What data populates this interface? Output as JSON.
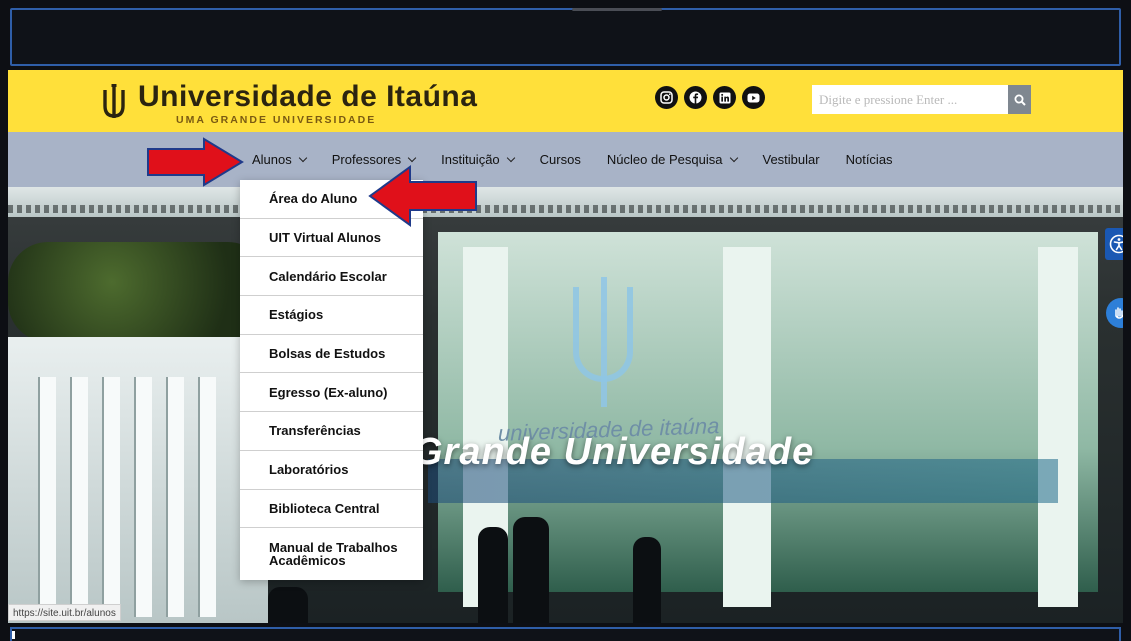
{
  "header": {
    "logo_title": "Universidade de Itaúna",
    "logo_subtitle": "UMA GRANDE UNIVERSIDADE",
    "social_icons": [
      "instagram-icon",
      "facebook-icon",
      "linkedin-icon",
      "youtube-icon"
    ],
    "search_placeholder": "Digite e pressione Enter ..."
  },
  "nav": {
    "items": [
      {
        "label": "Alunos",
        "has_dropdown": true
      },
      {
        "label": "Professores",
        "has_dropdown": true
      },
      {
        "label": "Instituição",
        "has_dropdown": true
      },
      {
        "label": "Cursos",
        "has_dropdown": false
      },
      {
        "label": "Núcleo de Pesquisa",
        "has_dropdown": true
      },
      {
        "label": "Vestibular",
        "has_dropdown": false
      },
      {
        "label": "Notícias",
        "has_dropdown": false
      }
    ]
  },
  "dropdown": {
    "items": [
      "Área do Aluno",
      "UIT Virtual Alunos",
      "Calendário Escolar",
      "Estágios",
      "Bolsas de Estudos",
      "Egresso (Ex-aluno)",
      "Transferências",
      "Laboratórios",
      "Biblioteca Central",
      "Manual de Trabalhos Acadêmicos"
    ]
  },
  "hero": {
    "title": "Grande Universidade",
    "building_sign": "universidade de itaúna"
  },
  "status_bar": {
    "url": "https://site.uit.br/alunos"
  },
  "colors": {
    "header_yellow": "#ffe03a",
    "nav_blue_gray": "#a8b3c7",
    "annotation_red": "#e0101a",
    "accessibility_blue": "#1a58b3"
  }
}
